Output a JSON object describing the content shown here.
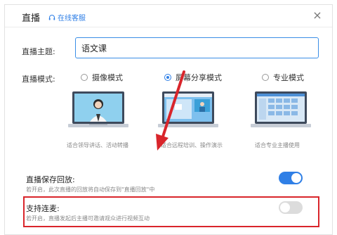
{
  "header": {
    "title": "直播",
    "service_link": "在线客服",
    "close_label": "×"
  },
  "topic": {
    "label": "直播主题:",
    "value": "语文课"
  },
  "mode": {
    "label": "直播模式:",
    "options": [
      {
        "label": "摄像模式",
        "checked": false,
        "caption": "适合领导讲话、活动转播"
      },
      {
        "label": "屏幕分享模式",
        "checked": true,
        "caption": "适合远程培训、操作演示"
      },
      {
        "label": "专业模式",
        "checked": false,
        "caption": "适合专业主播使用"
      }
    ]
  },
  "save_replay": {
    "title": "直播保存回放:",
    "description": "若开启，此次直播的回放将自动保存到\"直播回放\"中",
    "enabled": true
  },
  "co_host": {
    "title": "支持连麦:",
    "description": "若开启，直播发起后主播可邀请观众进行视频互动",
    "enabled": false
  },
  "colors": {
    "accent": "#2f7fe6",
    "highlight": "#d9252b",
    "arrow": "#d9252b"
  }
}
